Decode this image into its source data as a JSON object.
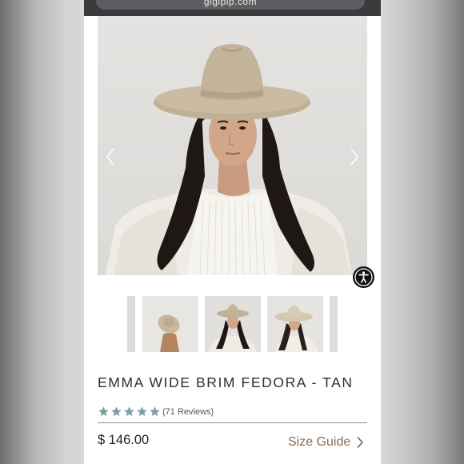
{
  "browser": {
    "url": "gigipip.com",
    "lock_icon": "lock-icon",
    "reload_icon": "reload-icon"
  },
  "gallery": {
    "main_image": "woman wearing tan wide brim fedora",
    "prev_icon": "chevron-left-icon",
    "next_icon": "chevron-right-icon",
    "thumbnails": [
      "hat-flatlay",
      "model-front",
      "model-side"
    ]
  },
  "accessibility": {
    "icon": "accessibility-icon"
  },
  "product": {
    "title": "EMMA WIDE BRIM FEDORA - TAN",
    "rating": 5,
    "reviews_label": "(71 Reviews)",
    "price": "$ 146.00",
    "size_guide_label": "Size Guide"
  },
  "colors": {
    "star": "#7ba1a6",
    "size_guide": "#8a6a4a",
    "hat": "#bfae96"
  }
}
